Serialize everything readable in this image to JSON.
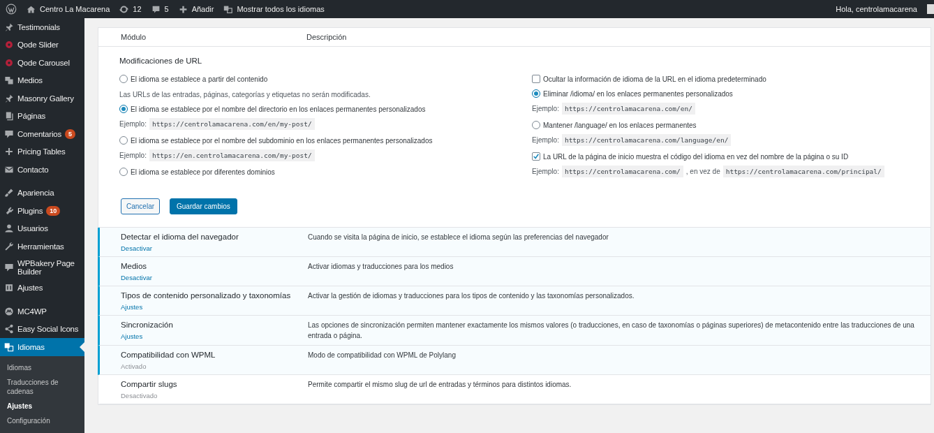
{
  "admin_bar": {
    "site": "Centro La Macarena",
    "updates": "12",
    "comments": "5",
    "add": "Añadir",
    "languages": "Mostrar todos los idiomas",
    "greeting": "Hola, centrolamacarena"
  },
  "sidebar": {
    "groups": [
      [
        {
          "label": "Testimonials",
          "selected": false
        },
        {
          "label": "Qode Slider",
          "selected": false
        },
        {
          "label": "Qode Carousel",
          "selected": false
        },
        {
          "label": "Medios",
          "selected": false
        },
        {
          "label": "Masonry Gallery",
          "selected": false
        },
        {
          "label": "Páginas",
          "selected": false
        },
        {
          "label": "Comentarios",
          "selected": false,
          "badge": "5"
        },
        {
          "label": "Pricing Tables",
          "selected": false
        },
        {
          "label": "Contacto",
          "selected": false
        }
      ],
      [
        {
          "label": "Apariencia",
          "selected": false
        },
        {
          "label": "Plugins",
          "selected": false,
          "badge": "10"
        },
        {
          "label": "Usuarios",
          "selected": false
        },
        {
          "label": "Herramientas",
          "selected": false
        },
        {
          "label": "WPBakery Page Builder",
          "selected": false
        },
        {
          "label": "Ajustes",
          "selected": false
        }
      ],
      [
        {
          "label": "MC4WP",
          "selected": false
        },
        {
          "label": "Easy Social Icons",
          "selected": false
        },
        {
          "label": "Idiomas",
          "selected": true
        }
      ]
    ],
    "submenu": [
      {
        "label": "Idiomas",
        "selected": false
      },
      {
        "label": "Traducciones de cadenas",
        "selected": false
      },
      {
        "label": "Ajustes",
        "selected": true
      },
      {
        "label": "Configuración",
        "selected": false
      }
    ]
  },
  "table": {
    "columns": [
      "Módulo",
      "Descripción"
    ],
    "url_settings": {
      "title": "Modificaciones de URL",
      "left": [
        {
          "kind": "radio",
          "label": "El idioma se establece a partir del contenido",
          "selected": false,
          "note": "Las URLs de las entradas, páginas, categorías y etiquetas no serán modificadas."
        },
        {
          "kind": "radio",
          "label": "El idioma se establece por el nombre del directorio en los enlaces permanentes personalizados",
          "selected": true,
          "example": {
            "label": "Ejemplo:",
            "code": "https://centrolamacarena.com/en/my-post/"
          }
        },
        {
          "kind": "radio",
          "label": "El idioma se establece por el nombre del subdominio en los enlaces permanentes personalizados",
          "selected": false,
          "example": {
            "label": "Ejemplo:",
            "code": "https://en.centrolamacarena.com/my-post/"
          }
        },
        {
          "kind": "radio",
          "label": "El idioma se establece por diferentes dominios",
          "selected": false
        }
      ],
      "right": [
        {
          "kind": "checkbox",
          "label": "Ocultar la información de idioma de la URL en el idioma predeterminado",
          "checked": false
        },
        {
          "kind": "radio",
          "label": "Eliminar /idioma/ en los enlaces permanentes personalizados",
          "selected": true,
          "example": {
            "label": "Ejemplo:",
            "code": "https://centrolamacarena.com/en/"
          }
        },
        {
          "kind": "radio",
          "label": "Mantener /language/ en los enlaces permanentes",
          "selected": false,
          "example": {
            "label": "Ejemplo:",
            "code": "https://centrolamacarena.com/language/en/"
          }
        },
        {
          "kind": "checkbox",
          "label": "La URL de la página de inicio muestra el código del idioma en vez del nombre de la página o su ID",
          "checked": true,
          "example": {
            "label": "Ejemplo:",
            "code": "https://centrolamacarena.com/",
            "middle": ", en vez de",
            "code2": "https://centrolamacarena.com/principal/"
          }
        }
      ],
      "buttons": [
        {
          "label": "Cancelar",
          "kind": "secondary"
        },
        {
          "label": "Guardar cambios",
          "kind": "primary"
        }
      ]
    },
    "modules": [
      {
        "name": "Detectar el idioma del navegador",
        "action": "Desactivar",
        "action_disabled": false,
        "active": true,
        "description": "Cuando se visita la página de inicio, se establece el idioma según las preferencias del navegador"
      },
      {
        "name": "Medios",
        "action": "Desactivar",
        "action_disabled": false,
        "active": true,
        "description": "Activar idiomas y traducciones para los medios"
      },
      {
        "name": "Tipos de contenido personalizado y taxonomías",
        "action": "Ajustes",
        "action_disabled": false,
        "active": true,
        "description": "Activar la gestión de idiomas y traducciones para los tipos de contenido y las taxonomías personalizados."
      },
      {
        "name": "Sincronización",
        "action": "Ajustes",
        "action_disabled": false,
        "active": true,
        "description": "Las opciones de sincronización permiten mantener exactamente los mismos valores (o traducciones, en caso de taxonomías o páginas superiores) de metacontenido entre las traducciones de una entrada o página."
      },
      {
        "name": "Compatibilidad con WPML",
        "action": "Activado",
        "action_disabled": true,
        "active": true,
        "description": "Modo de compatibilidad con WPML de Polylang"
      },
      {
        "name": "Compartir slugs",
        "action": "Desactivado",
        "action_disabled": true,
        "active": false,
        "description": "Permite compartir el mismo slug de url de entradas y términos para distintos idiomas."
      }
    ]
  }
}
